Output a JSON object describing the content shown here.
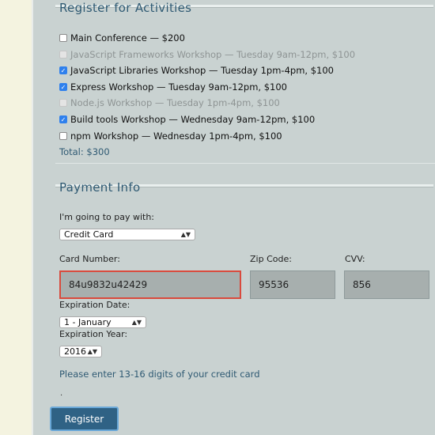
{
  "activities": {
    "legend": "Register for Activities",
    "items": [
      {
        "label": "Main Conference — $200",
        "checked": false,
        "disabled": false
      },
      {
        "label": "JavaScript Frameworks Workshop — Tuesday 9am-12pm, $100",
        "checked": false,
        "disabled": true
      },
      {
        "label": "JavaScript Libraries Workshop — Tuesday 1pm-4pm, $100",
        "checked": true,
        "disabled": false
      },
      {
        "label": "Express Workshop — Tuesday 9am-12pm, $100",
        "checked": true,
        "disabled": false
      },
      {
        "label": "Node.js Workshop — Tuesday 1pm-4pm, $100",
        "checked": false,
        "disabled": true
      },
      {
        "label": "Build tools Workshop — Wednesday 9am-12pm, $100",
        "checked": true,
        "disabled": false
      },
      {
        "label": "npm Workshop — Wednesday 1pm-4pm, $100",
        "checked": false,
        "disabled": false
      }
    ],
    "total": "Total: $300"
  },
  "payment": {
    "legend": "Payment Info",
    "pay_with_label": "I'm going to pay with:",
    "pay_with_value": "Credit Card",
    "card_number_label": "Card Number:",
    "card_number_value": "84u9832u42429",
    "zip_label": "Zip Code:",
    "zip_value": "95536",
    "cvv_label": "CVV:",
    "cvv_value": "856",
    "exp_date_label": "Expiration Date:",
    "exp_date_value": "1 - January",
    "exp_year_label": "Expiration Year:",
    "exp_year_value": "2016",
    "hint": "Please enter 13-16 digits of your credit card",
    "dot": "."
  },
  "register_button": "Register"
}
